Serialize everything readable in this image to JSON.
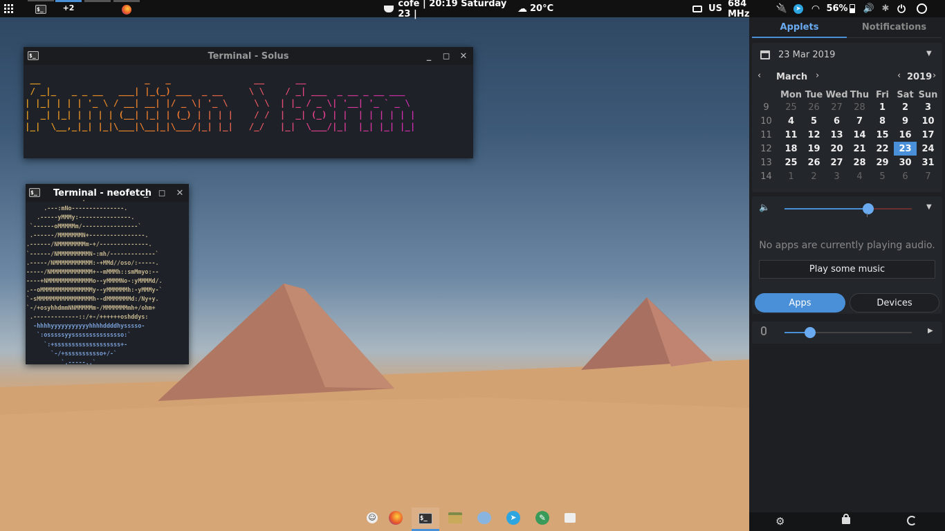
{
  "topbar": {
    "workspace_count": "+2",
    "status": "cofe | 20:19 Saturday 23 |",
    "weather": "20°C",
    "keyboard_layout": "US",
    "cpu_freq": "684 MHz",
    "battery": "56%"
  },
  "windows": {
    "solus": {
      "title": "Terminal - Solus",
      "ascii": " __                    _   _                __      __\n / _|_   _ _ __   ___| |_(_) ___  _ __     \\ \\    / _| ___  _ __ _ __ ___\n| |_| | | | '_ \\ / __| __| |/ _ \\| '_ \\     \\ \\  | |_ / _ \\| '__| '_ ` _ \\\n|  _| |_| | | | | (__| |_| | (_) | | | |    / /  |  _| (_) | |  | | | | | |\n|_|  \\__,_|_| |_|\\___|\\__|_|\\___/|_| |_|   /_/   |_|  \\___/|_|  |_| |_| |_|"
    },
    "neofetch": {
      "title": "Terminal - neofetch",
      "ascii": "                .\n     .---:mNo---------------.\n   .-----yMMMy:---------------.\n `------oMMMMMm/----------------`\n .------/MMMMMMMN+----------------.\n.------/NMMMMMMMMm-+/--------------.\n`------/NMMMMMMMMMN-:mh/-------------`\n.-----/NMMMMMMMMMMM:-+MMd//oso/:-----.\n-----/NMMMMMMMMMMMM+--mMMMh::smMmyo:--\n----+NMMMMMMMMMMMMMo--yMMMMNo-:yMMMMd/.\n.--oMMMMMMMMMMMMMMMy--yMMMMMMh:-yMMMy-`\n`-sMMMMMMMMMMMMMMMMh--dMMMMMMMd:/Ny+y.\n`-/+osyhhdmmNNMMMMMm-/MMMMMMMmh+/ohm+\n .-------------::/+-/++++++oshddys:\n  -hhhhyyyyyyyyyyyhhhhddddhysssso-\n   `:osssssyysssssssssssssso:`\n     `:+sssssssssssssssssss+-\n       `-/+sssssssssso+/-`\n          `.-----..`"
    }
  },
  "panel": {
    "tabs": [
      "Applets",
      "Notifications"
    ],
    "date": "23 Mar 2019",
    "month": "March",
    "year": "2019",
    "weekdays": [
      "Mon",
      "Tue",
      "Wed",
      "Thu",
      "Fri",
      "Sat",
      "Sun"
    ],
    "weeks": [
      {
        "wk": "9",
        "days": [
          "25",
          "26",
          "27",
          "28",
          "1",
          "2",
          "3"
        ]
      },
      {
        "wk": "10",
        "days": [
          "4",
          "5",
          "6",
          "7",
          "8",
          "9",
          "10"
        ]
      },
      {
        "wk": "11",
        "days": [
          "11",
          "12",
          "13",
          "14",
          "15",
          "16",
          "17"
        ]
      },
      {
        "wk": "12",
        "days": [
          "18",
          "19",
          "20",
          "21",
          "22",
          "23",
          "24"
        ]
      },
      {
        "wk": "13",
        "days": [
          "25",
          "26",
          "27",
          "28",
          "29",
          "30",
          "31"
        ]
      },
      {
        "wk": "14",
        "days": [
          "1",
          "2",
          "3",
          "4",
          "5",
          "6",
          "7"
        ]
      }
    ],
    "no_audio": "No apps are currently playing audio.",
    "play_music": "Play some music",
    "apps": "Apps",
    "devices": "Devices",
    "volume_level": 0.66,
    "mic_level": 0.2
  },
  "colors": {
    "accent": "#4a90d9"
  }
}
